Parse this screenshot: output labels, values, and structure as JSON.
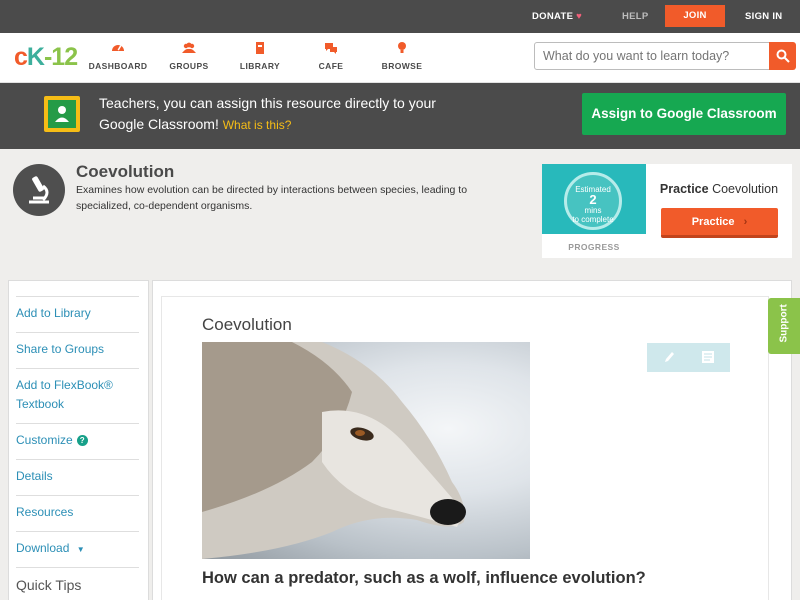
{
  "topbar": {
    "donate": "DONATE",
    "help": "HELP",
    "join": "JOIN",
    "signin": "SIGN IN"
  },
  "nav": {
    "logo": "cK-12",
    "items": [
      {
        "label": "DASHBOARD",
        "icon": "dashboard-icon"
      },
      {
        "label": "GROUPS",
        "icon": "groups-icon"
      },
      {
        "label": "LIBRARY",
        "icon": "library-icon"
      },
      {
        "label": "CAFE",
        "icon": "cafe-icon"
      },
      {
        "label": "BROWSE",
        "icon": "browse-icon"
      }
    ],
    "search_placeholder": "What do you want to learn today?"
  },
  "banner": {
    "text": "Teachers, you can assign this resource directly to your Google Classroom!",
    "link": "What is this?",
    "button": "Assign to Google Classroom"
  },
  "concept": {
    "title": "Coevolution",
    "description": "Examines how evolution can be directed by interactions between species, leading to specialized, co-dependent organisms."
  },
  "progress": {
    "estimated": "Estimated",
    "minutes": "2",
    "unit": "mins",
    "to_complete": "to complete",
    "label": "PROGRESS",
    "practice_bold": "Practice",
    "practice_title": "Coevolution",
    "practice_button": "Practice"
  },
  "sidebar": {
    "items": [
      {
        "label": "Add to Library"
      },
      {
        "label": "Share to Groups"
      },
      {
        "label": "Add to FlexBook® Textbook"
      },
      {
        "label": "Customize"
      },
      {
        "label": "Details"
      },
      {
        "label": "Resources"
      },
      {
        "label": "Download"
      }
    ],
    "quick_tips": "Quick Tips"
  },
  "article": {
    "title": "Coevolution",
    "question": "How can a predator, such as a wolf, influence evolution?"
  },
  "support": "Support",
  "colors": {
    "brand_orange": "#f15b2a",
    "google_green": "#16a851",
    "link_blue": "#2c8fb6",
    "dark_bar": "#4b4b4b"
  }
}
